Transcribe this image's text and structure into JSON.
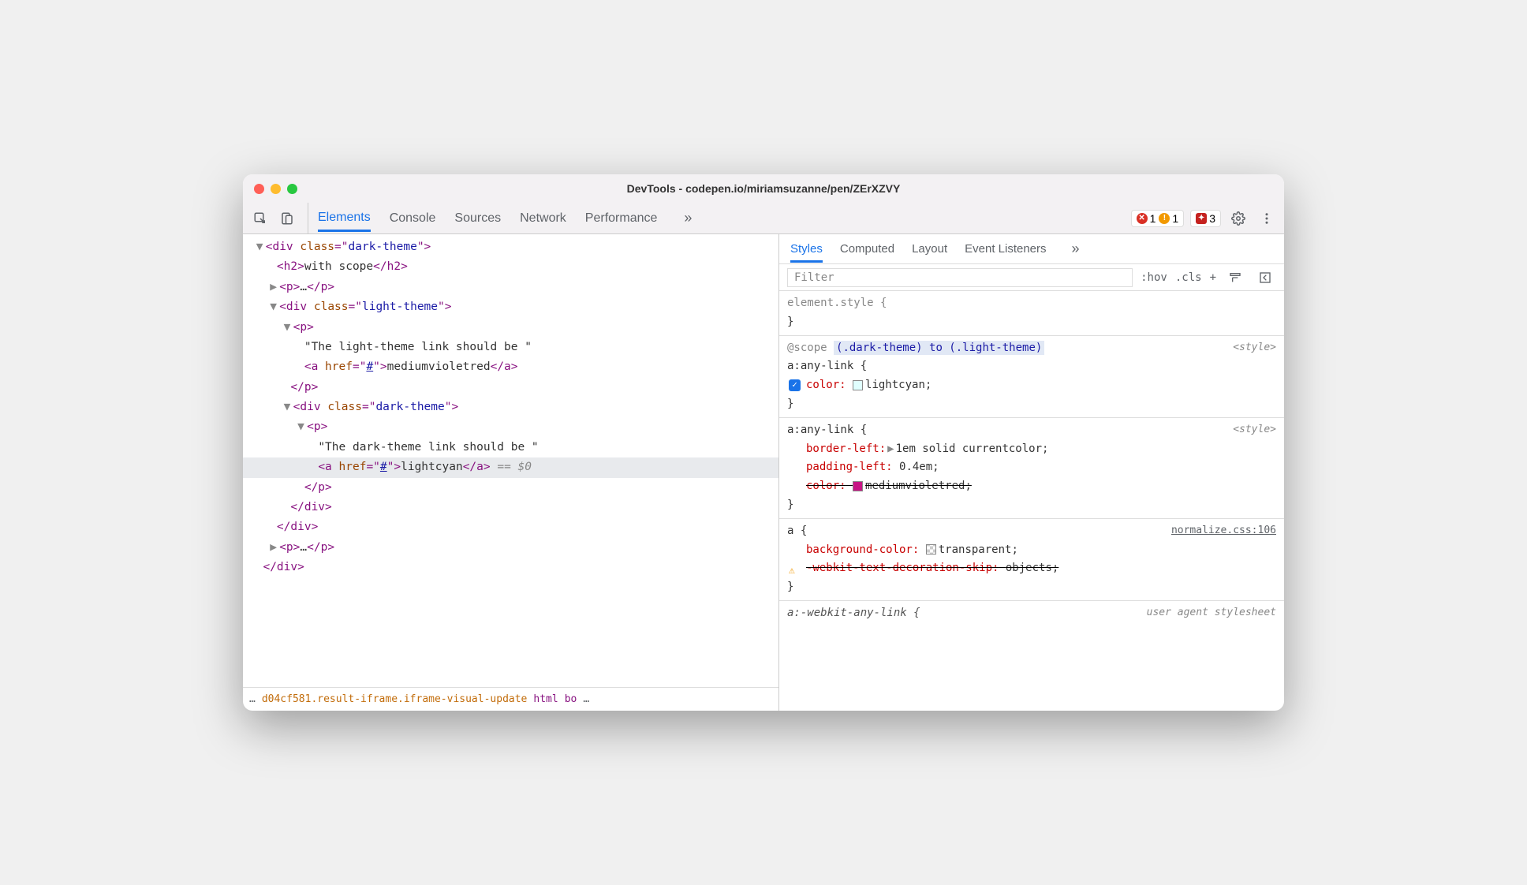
{
  "window": {
    "title": "DevTools - codepen.io/miriamsuzanne/pen/ZErXZVY"
  },
  "mainTabs": {
    "items": [
      "Elements",
      "Console",
      "Sources",
      "Network",
      "Performance"
    ],
    "activeIndex": 0,
    "moreGlyph": "»"
  },
  "badges": {
    "errors": "1",
    "warnings": "1",
    "issues": "3"
  },
  "dom": {
    "l0": "<div class=\"dark-theme\">",
    "l1_open": "<h2>",
    "l1_text": "with scope",
    "l1_close": "</h2>",
    "l2": "<p>…</p>",
    "l3": "<div class=\"light-theme\">",
    "l4": "<p>",
    "l5_text": "\"The light-theme link should be \"",
    "l6_open": "<a href=\"#\">",
    "l6_text": "mediumvioletred",
    "l6_close": "</a>",
    "l7": "</p>",
    "l8": "<div class=\"dark-theme\">",
    "l9": "<p>",
    "l10_text": "\"The dark-theme link should be \"",
    "l11_open": "<a href=\"#\">",
    "l11_text": "lightcyan",
    "l11_close": "</a>",
    "l11_ref": " == $0",
    "l12": "</p>",
    "l13": "</div>",
    "l14": "</div>",
    "l15": "<p>…</p>",
    "l16": "</div>"
  },
  "breadcrumb": {
    "ellipsis": "…",
    "item1": "d04cf581.result-iframe.iframe-visual-update",
    "item2": "html",
    "item3": "bo",
    "trailEllipsis": "…"
  },
  "subTabs": {
    "items": [
      "Styles",
      "Computed",
      "Layout",
      "Event Listeners"
    ],
    "activeIndex": 0,
    "moreGlyph": "»"
  },
  "stylesToolbar": {
    "filterPlaceholder": "Filter",
    "hov": ":hov",
    "cls": ".cls",
    "plus": "+"
  },
  "rules": {
    "r0": {
      "selector": "element.style {",
      "close": "}"
    },
    "r1": {
      "scope_kw": "@scope",
      "scope_expr": "(.dark-theme) to (.light-theme)",
      "selector": "a:any-link {",
      "source": "<style>",
      "p1_name": "color:",
      "p1_swatch": "#e0ffff",
      "p1_val": "lightcyan;",
      "close": "}"
    },
    "r2": {
      "selector": "a:any-link {",
      "source": "<style>",
      "p1_name": "border-left:",
      "p1_val": "1em solid currentcolor;",
      "p2_name": "padding-left:",
      "p2_val": "0.4em;",
      "p3_name": "color:",
      "p3_swatch": "#c71585",
      "p3_val": "mediumvioletred;",
      "close": "}"
    },
    "r3": {
      "selector": "a {",
      "source": "normalize.css:106",
      "p1_name": "background-color:",
      "p1_swatch": "transparent",
      "p1_val": "transparent;",
      "p2_name": "-webkit-text-decoration-skip:",
      "p2_val": "objects;",
      "close": "}"
    },
    "r4": {
      "selector": "a:-webkit-any-link {",
      "source": "user agent stylesheet"
    }
  }
}
